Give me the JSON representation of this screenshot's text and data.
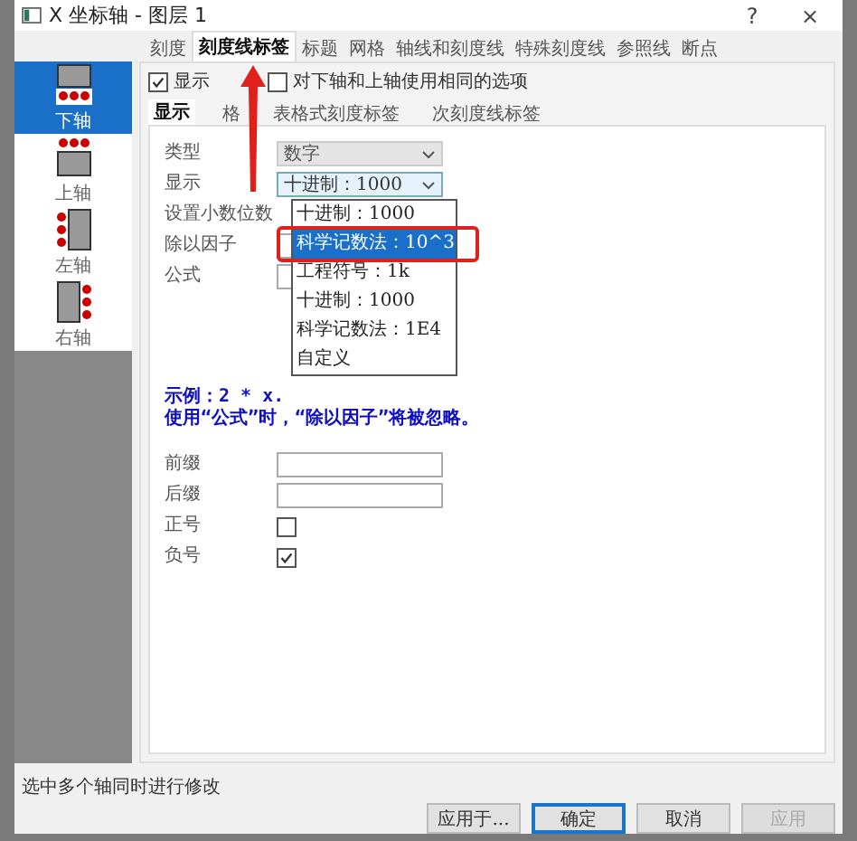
{
  "window": {
    "title": "X 坐标轴 - 图层 1",
    "help": "?",
    "close": "×"
  },
  "tabs": [
    {
      "label": "刻度",
      "selected": false
    },
    {
      "label": "刻度线标签",
      "selected": true
    },
    {
      "label": "标题",
      "selected": false
    },
    {
      "label": "网格",
      "selected": false
    },
    {
      "label": "轴线和刻度线",
      "selected": false
    },
    {
      "label": "特殊刻度线",
      "selected": false
    },
    {
      "label": "参照线",
      "selected": false
    },
    {
      "label": "断点",
      "selected": false
    }
  ],
  "sidebar": {
    "items": [
      {
        "label": "下轴",
        "kind": "bottom",
        "selected": true
      },
      {
        "label": "上轴",
        "kind": "top",
        "selected": false
      },
      {
        "label": "左轴",
        "kind": "left",
        "selected": false
      },
      {
        "label": "右轴",
        "kind": "right",
        "selected": false
      }
    ]
  },
  "options": [
    {
      "label": "显示",
      "checked": true
    },
    {
      "label": "对下轴和上轴使用相同的选项",
      "checked": false
    }
  ],
  "inner_tabs": [
    {
      "label": "显示",
      "selected": true
    },
    {
      "label": "格",
      "selected": false
    },
    {
      "label": "表格式刻度标签",
      "selected": false
    },
    {
      "label": "次刻度线标签",
      "selected": false
    }
  ],
  "fields": [
    {
      "label": "类型",
      "kind": "select",
      "value": "数字",
      "disabled": true
    },
    {
      "label": "显示",
      "kind": "select",
      "value": "十进制：1000",
      "disabled": false
    },
    {
      "label": "设置小数位数",
      "kind": "blank"
    },
    {
      "label": "除以因子",
      "kind": "input"
    },
    {
      "label": "公式",
      "kind": "input"
    }
  ],
  "dropdown": {
    "items": [
      {
        "label": "十进制：1000",
        "selected": false
      },
      {
        "label": "科学记数法：10^3",
        "selected": true
      },
      {
        "label": "工程符号：1k",
        "selected": false
      },
      {
        "label": "十进制：1000",
        "selected": false
      },
      {
        "label": "科学记数法：1E4",
        "selected": false
      },
      {
        "label": "自定义",
        "selected": false
      }
    ]
  },
  "example": [
    "示例：2 * x.",
    "使用“公式”时，“除以因子”将被忽略。"
  ],
  "extra_fields": [
    {
      "label": "前缀",
      "kind": "input"
    },
    {
      "label": "后缀",
      "kind": "input"
    },
    {
      "label": "正号",
      "kind": "checkbox",
      "checked": false
    },
    {
      "label": "负号",
      "kind": "checkbox",
      "checked": true
    }
  ],
  "status": "选中多个轴同时进行修改",
  "buttons": [
    {
      "label": "应用于...",
      "default": false,
      "disabled": false
    },
    {
      "label": "确定",
      "default": true,
      "disabled": false
    },
    {
      "label": "取消",
      "default": false,
      "disabled": false
    },
    {
      "label": "应用",
      "default": false,
      "disabled": true
    }
  ]
}
